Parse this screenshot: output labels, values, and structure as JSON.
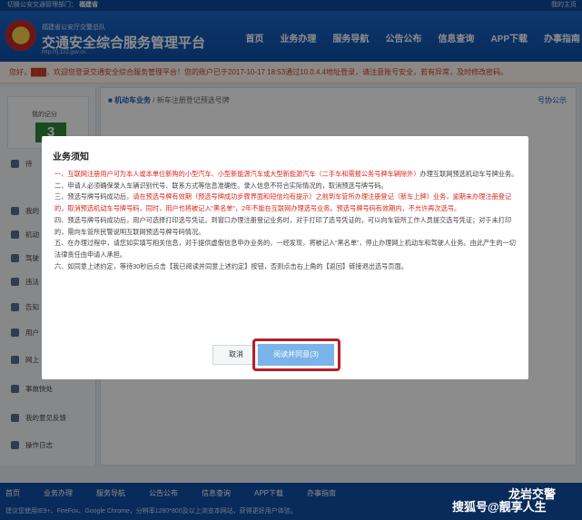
{
  "topbar": {
    "left": "切换公安交通管理部门：",
    "city": "福建省",
    "right": "我的主页"
  },
  "header": {
    "logo_sub": "福建省公安厅交警总队",
    "logo_title": "交通安全综合服务管理平台",
    "logo_url": "http://fj.122.gov.cn",
    "nav": [
      "首页",
      "业务办理",
      "服务导航",
      "公告公布",
      "信息查询",
      "APP下载",
      "办事指南"
    ]
  },
  "notice": "您好，███，欢迎您登录交通安全综合服务管理平台！您的账户已于2017-10-17 18:53通过10.0.4.4地址登录，请注意账号安全，若有异常，及时修改密码。",
  "sidebar": {
    "score_label": "我的记分",
    "score_value": "3",
    "items": [
      "待",
      "我的",
      "机动",
      "驾驶",
      "违法",
      "告知",
      "用户",
      "网上",
      "事故快处",
      "我的意见反馈",
      "操作日志"
    ]
  },
  "content": {
    "crumb_main": "机动车业务",
    "crumb_sub": "新车注册登记预选号牌",
    "right_link": "号协公示"
  },
  "modal": {
    "title": "业务须知",
    "p1_red": "一、互联网注册用户可为本人或本单位新购的小型汽车、小型新能源汽车或大型新能源汽车（二手车和需报公务号牌车辆除外）",
    "p1_rest": "办理互联网预选机动车号牌业务。",
    "p2": "二、申请人必须确保录入车辆识别代号、联系方式等信息准确性。录入信息不符合实际情况的，取消预选号牌号码。",
    "p3_a": "三、预选号牌号码成功后，",
    "p3_red": "请在预选号牌有效期（预选号牌成功步骤界面和短信均有提示）之前到车管所办理注册登记（新车上牌）业务，逾期未办理注册登记的，取消预选机动车号牌号码，同时，用户也将被记入“黑名单”，2年不能在互联网办理选号业务。预选号牌号码有效期内，不允许再次选号。",
    "p4": "四、预选号牌号码成功后，用户可选择打印选号凭证。到窗口办理注册登记业务时，对于打印了选号凭证的，可以向车管所工作人员提交选号凭证；对于未打印的，需向车管所民警说明互联网预选号牌号码情况。",
    "p5": "五、在办理过程中，请您如实填写相关信息，对于提供虚假信息申办业务的，一经发现，将被记入“黑名单”，停止办理网上机动车和驾驶人业务。由此产生的一切法律责任由申请人承担。",
    "p6": "六、如同意上述约定，等待30秒后点击【我已阅读并同意上述约定】按钮，否则点击右上角的【返回】链接退出选号页面。",
    "cancel": "取消",
    "agree": "阅读并同意(3)"
  },
  "footer": {
    "nav": [
      "首页",
      "业务办理",
      "服务导航",
      "公告公布",
      "信息查询",
      "APP下载",
      "办事指南"
    ],
    "tip": "建议您使用IE9+、FireFox、Google Chrome，分辨率1280*800及以上浏览本网站，获得更好用户体验。"
  },
  "watermark": {
    "line1": "龙岩交警",
    "line2": "搜狐号@靓享人生"
  }
}
